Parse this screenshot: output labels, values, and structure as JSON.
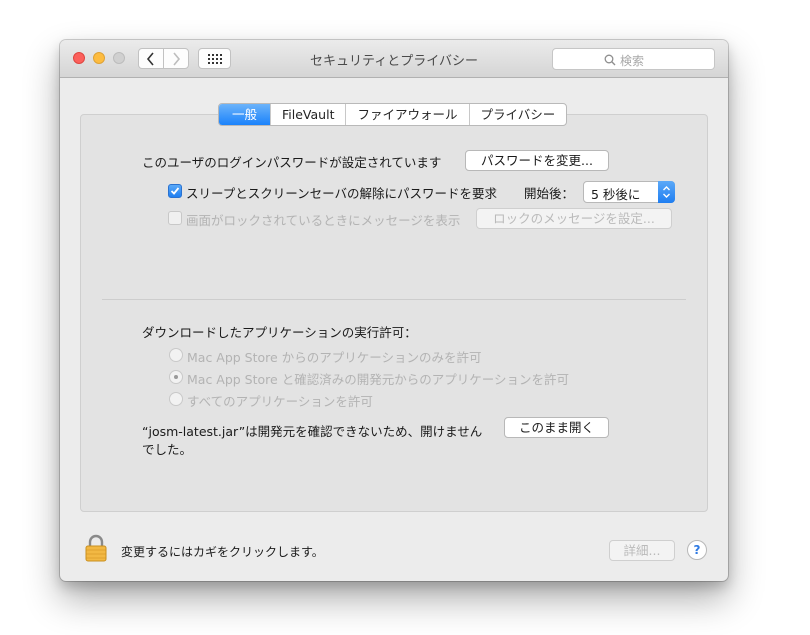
{
  "window": {
    "title": "セキュリティとプライバシー"
  },
  "toolbar": {
    "search_placeholder": "検索"
  },
  "tabs": [
    {
      "label": "一般",
      "active": true
    },
    {
      "label": "FileVault",
      "active": false
    },
    {
      "label": "ファイアウォール",
      "active": false
    },
    {
      "label": "プライバシー",
      "active": false
    }
  ],
  "general": {
    "password_status": "このユーザのログインパスワードが設定されています",
    "change_password_button": "パスワードを変更...",
    "require_password_label": "スリープとスクリーンセーバの解除にパスワードを要求",
    "require_password_checked": true,
    "after_label": "開始後：",
    "delay_value": "5 秒後に",
    "show_message_label": "画面がロックされているときにメッセージを表示",
    "show_message_checked": false,
    "set_lock_message_button": "ロックのメッセージを設定..."
  },
  "gatekeeper": {
    "heading": "ダウンロードしたアプリケーションの実行許可：",
    "options": [
      {
        "label": "Mac App Store からのアプリケーションのみを許可",
        "selected": false
      },
      {
        "label": "Mac App Store と確認済みの開発元からのアプリケーションを許可",
        "selected": true
      },
      {
        "label": "すべてのアプリケーションを許可",
        "selected": false
      }
    ],
    "blocked_line1": "“josm-latest.jar”は開発元を確認できないため、開けません",
    "blocked_line2": "でした。",
    "open_anyway_button": "このまま開く"
  },
  "footer": {
    "lock_text": "変更するにはカギをクリックします。",
    "advanced_button": "詳細...",
    "help_label": "?"
  },
  "colors": {
    "accent": "#1a82fb",
    "close": "#fc605c",
    "minimize": "#fdbc40",
    "lock": "#f2b843"
  }
}
